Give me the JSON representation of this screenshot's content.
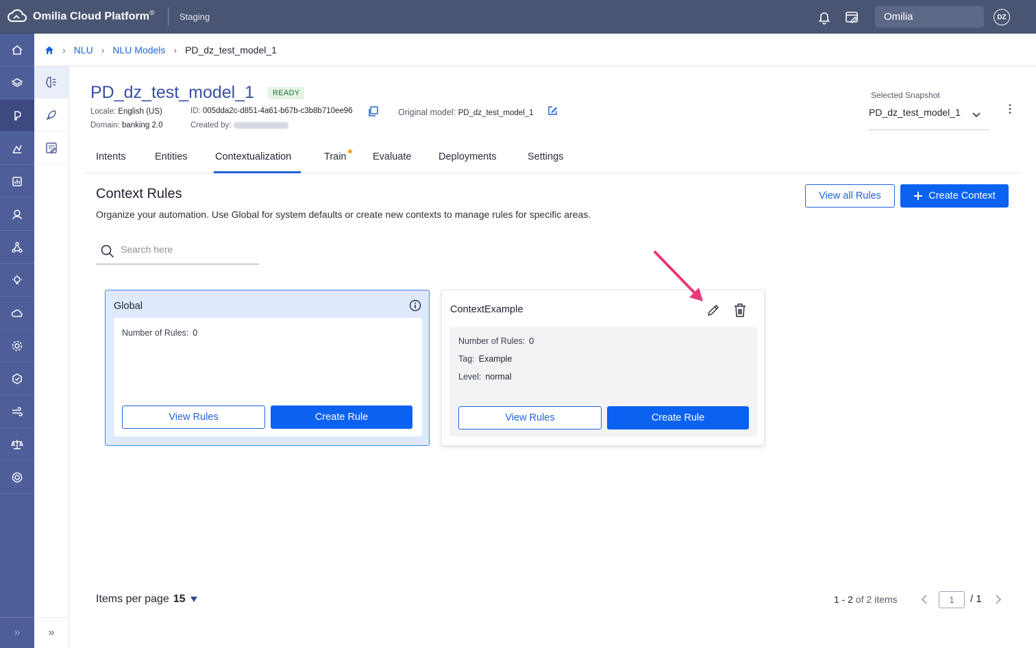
{
  "topbar": {
    "app_name": "Omilia Cloud Platform",
    "app_name_mark": "®",
    "environment": "Staging",
    "organization": "Omilia",
    "user_initials": "DZ"
  },
  "breadcrumb": {
    "items": [
      "NLU",
      "NLU Models"
    ],
    "current": "PD_dz_test_model_1"
  },
  "model": {
    "title": "PD_dz_test_model_1",
    "status": "READY",
    "locale_label": "Locale:",
    "locale": "English (US)",
    "id_label": "ID:",
    "id": "005dda2c-d851-4a61-b67b-c3b8b710ee96",
    "original_label": "Original model:",
    "original": "PD_dz_test_model_1",
    "domain_label": "Domain:",
    "domain": "banking 2.0",
    "created_label": "Created by:"
  },
  "snapshot": {
    "label": "Selected Snapshot",
    "value": "PD_dz_test_model_1"
  },
  "tabs": [
    {
      "label": "Intents"
    },
    {
      "label": "Entities"
    },
    {
      "label": "Contextualization"
    },
    {
      "label": "Train"
    },
    {
      "label": "Evaluate"
    },
    {
      "label": "Deployments"
    },
    {
      "label": "Settings"
    }
  ],
  "active_tab": "Contextualization",
  "section": {
    "title": "Context Rules",
    "description": "Organize your automation. Use Global for system defaults or create new contexts to manage rules for specific areas.",
    "view_all_label": "View all Rules",
    "create_context_label": "Create Context",
    "search_placeholder": "Search here"
  },
  "cards": {
    "global": {
      "title": "Global",
      "rules_label": "Number of Rules:",
      "rules_value": "0",
      "view_label": "View Rules",
      "create_label": "Create Rule"
    },
    "context": {
      "title": "ContextExample",
      "rules_label": "Number of Rules:",
      "rules_value": "0",
      "tag_label": "Tag:",
      "tag_value": "Example",
      "level_label": "Level:",
      "level_value": "normal",
      "view_label": "View Rules",
      "create_label": "Create Rule"
    }
  },
  "pagination": {
    "per_page_label": "Items per page",
    "per_page_value": "15",
    "range": "1 - 2",
    "range_of": "of 2 items",
    "page_value": "1",
    "total_pages": "/ 1"
  },
  "colors": {
    "topbar": "#4a5573",
    "rail": "#4e5e98",
    "primary": "#0b62f0",
    "link": "#1e63d6",
    "annotation_arrow": "#e8387a"
  }
}
